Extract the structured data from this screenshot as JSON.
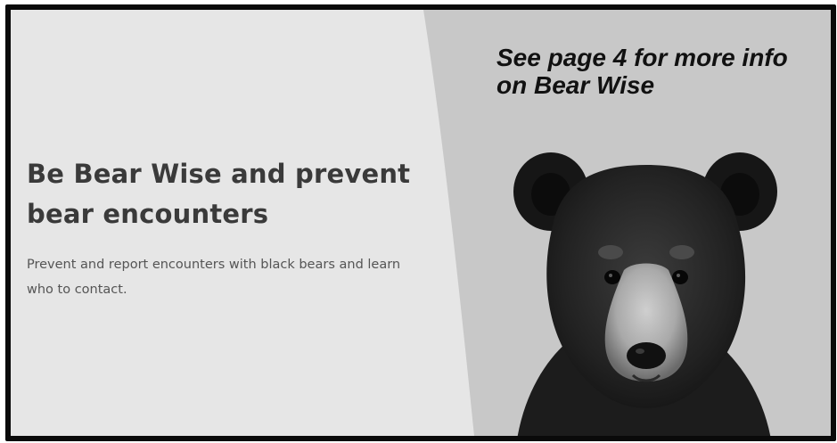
{
  "panel": {
    "note": "See page 4 for more info on Bear Wise",
    "headline": "Be Bear Wise and prevent bear encounters",
    "description": "Prevent and report encounters with black bears and learn who to contact.",
    "image": {
      "subject": "black bear",
      "icon": "bear-photo"
    }
  },
  "colors": {
    "left_background": "#e6e6e6",
    "right_background": "#c8c8c8",
    "frame_border": "#0a0a0a",
    "headline": "#3a3a3a",
    "description": "#555555"
  }
}
